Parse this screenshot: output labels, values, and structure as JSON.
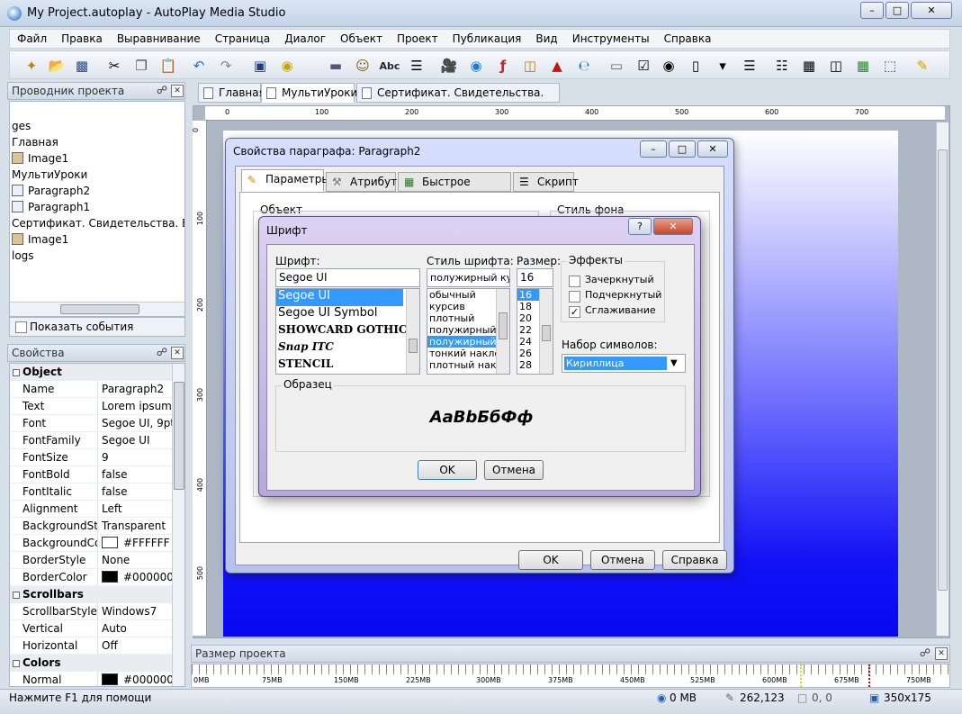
{
  "window": {
    "title": "My Project.autoplay - AutoPlay Media Studio"
  },
  "menu": [
    "Файл",
    "Правка",
    "Выравнивание",
    "Страница",
    "Диалог",
    "Объект",
    "Проект",
    "Публикация",
    "Вид",
    "Инструменты",
    "Справка"
  ],
  "toolbar": {
    "abc_label": "Abc",
    "icons": [
      "wand-icon",
      "open-folder-icon",
      "save-icon",
      "cut-icon",
      "copy-icon",
      "paste-icon",
      "undo-icon",
      "redo-icon",
      "preview-icon",
      "publish-icon",
      "button-object-icon",
      "image-object-icon",
      "label-object-icon",
      "paragraph-object-icon",
      "video-object-icon",
      "quicktime-object-icon",
      "flash-object-icon",
      "slideshow-object-icon",
      "pdf-object-icon",
      "web-object-icon",
      "input-object-icon",
      "checkbox-object-icon",
      "radio-object-icon",
      "text-object-icon",
      "combobox-object-icon",
      "listbox-object-icon",
      "grid-object-icon",
      "table-icon",
      "columns-icon",
      "tree-object-icon",
      "select-icon",
      "pencil-icon"
    ]
  },
  "explorer": {
    "title": "Проводник проекта",
    "items": [
      {
        "label": "",
        "icon": "none"
      },
      {
        "label": "ges",
        "icon": "none"
      },
      {
        "label": "Главная",
        "icon": "none"
      },
      {
        "label": "Image1",
        "icon": "image"
      },
      {
        "label": "МультиУроки",
        "icon": "none"
      },
      {
        "label": "Paragraph2",
        "icon": "paragraph"
      },
      {
        "label": "Paragraph1",
        "icon": "paragraph"
      },
      {
        "label": "Сертификат. Свидетельства. Визит",
        "icon": "none"
      },
      {
        "label": "Image1",
        "icon": "image"
      },
      {
        "label": "logs",
        "icon": "none"
      }
    ],
    "show_events_label": "Показать события"
  },
  "properties": {
    "title": "Свойства",
    "sections": [
      {
        "name": "Object",
        "rows": [
          {
            "key": "Name",
            "value": "Paragraph2"
          },
          {
            "key": "Text",
            "value": "Lorem ipsum c"
          },
          {
            "key": "Font",
            "value": "Segoe UI, 9pt"
          },
          {
            "key": "FontFamily",
            "value": "Segoe UI"
          },
          {
            "key": "FontSize",
            "value": "9"
          },
          {
            "key": "FontBold",
            "value": "false"
          },
          {
            "key": "FontItalic",
            "value": "false"
          },
          {
            "key": "Alignment",
            "value": "Left"
          },
          {
            "key": "BackgroundStyl",
            "value": "Transparent"
          },
          {
            "key": "BackgroundCol",
            "value": "#FFFFFF",
            "swatch": "#FFFFFF"
          },
          {
            "key": "BorderStyle",
            "value": "None"
          },
          {
            "key": "BorderColor",
            "value": "#000000",
            "swatch": "#000000"
          }
        ]
      },
      {
        "name": "Scrollbars",
        "rows": [
          {
            "key": "ScrollbarStyle",
            "value": "Windows7"
          },
          {
            "key": "Vertical",
            "value": "Auto"
          },
          {
            "key": "Horizontal",
            "value": "Off"
          }
        ]
      },
      {
        "name": "Colors",
        "rows": [
          {
            "key": "Normal",
            "value": "#000000",
            "swatch": "#000000"
          }
        ]
      }
    ]
  },
  "tabs": [
    {
      "label": "Главная",
      "active": false
    },
    {
      "label": "МультиУроки",
      "active": true
    },
    {
      "label": "Сертификат. Свидетельства. Визитка",
      "active": false
    }
  ],
  "ruler": {
    "h_marks": [
      "0",
      "100",
      "200",
      "300",
      "400",
      "500",
      "600",
      "700"
    ],
    "v_marks": [
      "0",
      "100",
      "200",
      "300",
      "400",
      "500"
    ]
  },
  "paragraph_dialog": {
    "title": "Свойства параграфа: Paragraph2",
    "tabs": [
      "Параметры",
      "Атрибуты",
      "Быстрое действие",
      "Скрипт"
    ],
    "object_group": "Объект",
    "bg_group": "Стиль фона",
    "ok": "OK",
    "cancel": "Отмена",
    "help": "Справка"
  },
  "font_dialog": {
    "title": "Шрифт",
    "help_glyph": "?",
    "font_label": "Шрифт:",
    "font_value": "Segoe UI",
    "fonts": [
      "Segoe UI",
      "Segoe UI Symbol",
      "SHOWCARD GOTHIC",
      "Snap ITC",
      "STENCIL"
    ],
    "style_label": "Стиль шрифта:",
    "style_value": "полужирный курс",
    "styles": [
      "обычный",
      "курсив",
      "плотный",
      "полужирный",
      "полужирный к",
      "тонкий наклон",
      "плотный накл"
    ],
    "size_label": "Размер:",
    "size_value": "16",
    "sizes": [
      "16",
      "18",
      "20",
      "22",
      "24",
      "26",
      "28"
    ],
    "effects_label": "Эффекты",
    "strikeout_label": "Зачеркнутый",
    "underline_label": "Подчеркнутый",
    "smoothing_label": "Сглаживание",
    "charset_label": "Набор символов:",
    "charset_value": "Кириллица",
    "sample_label": "Образец",
    "sample_text": "AaBbБбФф",
    "ok": "OK",
    "cancel": "Отмена"
  },
  "size_panel": {
    "title": "Размер проекта",
    "marks": [
      "0MB",
      "75MB",
      "150MB",
      "225MB",
      "300MB",
      "375MB",
      "450MB",
      "525MB",
      "600MB",
      "675MB",
      "750MB"
    ]
  },
  "status": {
    "help_text": "Нажмите F1 для помощи",
    "size": "0 MB",
    "objects": "262,123",
    "position": "0, 0",
    "dimensions": "350x175"
  },
  "colors": {
    "accent": "#3399ff",
    "page_bottom": "#0808f0"
  }
}
